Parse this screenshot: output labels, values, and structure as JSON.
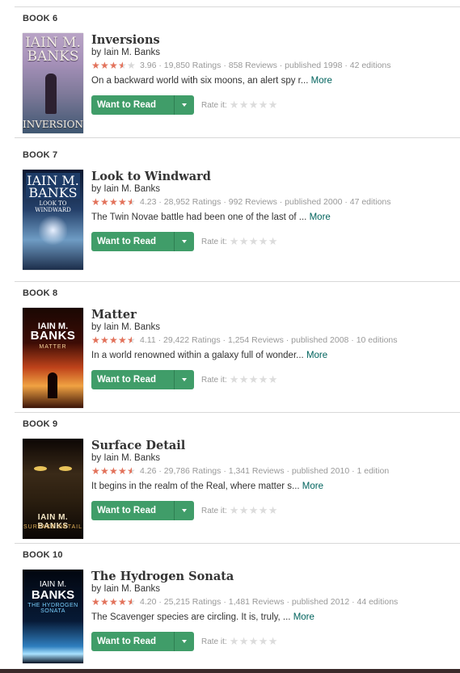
{
  "books": [
    {
      "label": "BOOK 6",
      "title": "Inversions",
      "author": "by Iain M. Banks",
      "rating_value": 3.96,
      "meta": "3.96 · 19,850 Ratings · 858 Reviews · published 1998 · 42 editions",
      "desc": "On a backward world with six moons, an alert spy r...",
      "more": "More",
      "button": "Want to Read",
      "rate_label": "Rate it:",
      "cover": {
        "top": "IAIN M. BANKS",
        "bottom": "INVERSIONS"
      }
    },
    {
      "label": "BOOK 7",
      "title": "Look to Windward",
      "author": "by Iain M. Banks",
      "rating_value": 4.23,
      "meta": "4.23 · 28,952 Ratings · 992 Reviews · published 2000 · 47 editions",
      "desc": "The Twin Novae battle had been one of the last of ...",
      "more": "More",
      "button": "Want to Read",
      "rate_label": "Rate it:",
      "cover": {
        "top": "IAIN M. BANKS",
        "bottom": "LOOK TO WINDWARD"
      }
    },
    {
      "label": "BOOK 8",
      "title": "Matter",
      "author": "by Iain M. Banks",
      "rating_value": 4.11,
      "meta": "4.11 · 29,422 Ratings · 1,254 Reviews · published 2008 · 10 editions",
      "desc": "In a world renowned within a galaxy full of wonder...",
      "more": "More",
      "button": "Want to Read",
      "rate_label": "Rate it:",
      "cover": {
        "top": "IAIN M.",
        "middle": "BANKS",
        "bottom": "MATTER"
      }
    },
    {
      "label": "BOOK 9",
      "title": "Surface Detail",
      "author": "by Iain M. Banks",
      "rating_value": 4.26,
      "meta": "4.26 · 29,786 Ratings · 1,341 Reviews · published 2010 · 1 edition",
      "desc": "It begins in the realm of the Real, where matter s...",
      "more": "More",
      "button": "Want to Read",
      "rate_label": "Rate it:",
      "cover": {
        "top": "IAIN M. BANKS",
        "bottom": "SURFACE DETAIL"
      }
    },
    {
      "label": "BOOK 10",
      "title": "The Hydrogen Sonata",
      "author": "by Iain M. Banks",
      "rating_value": 4.2,
      "meta": "4.20 · 25,215 Ratings · 1,481 Reviews · published 2012 · 44 editions",
      "desc": "The Scavenger species are circling. It is, truly, ...",
      "more": "More",
      "button": "Want to Read",
      "rate_label": "Rate it:",
      "cover": {
        "top": "IAIN M.",
        "middle": "BANKS",
        "bottom": "THE HYDROGEN SONATA"
      }
    }
  ],
  "colors": {
    "star": "#e2725b",
    "button": "#409d69",
    "link": "#00635d"
  },
  "icons": {
    "star": "star-icon",
    "dropdown": "caret-down-icon"
  }
}
